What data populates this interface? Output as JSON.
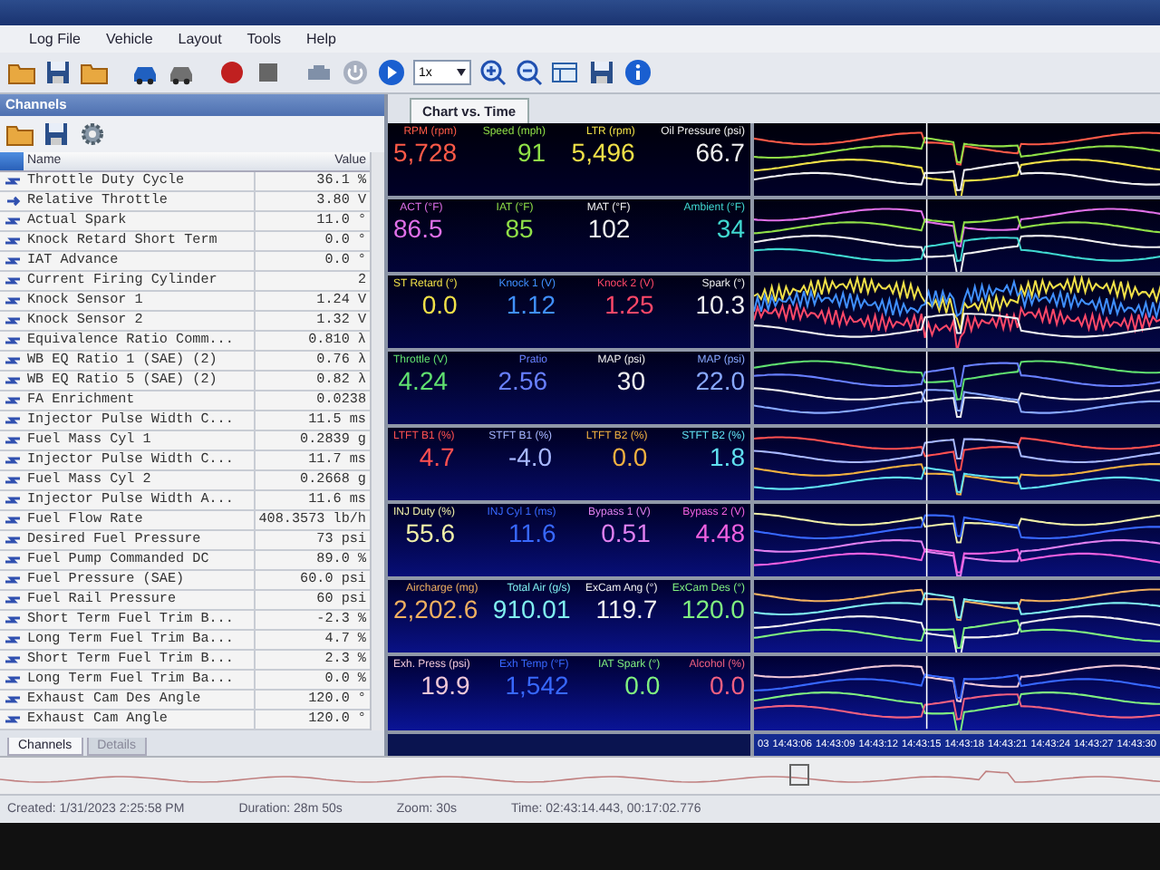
{
  "menu": [
    "Log File",
    "Vehicle",
    "Layout",
    "Tools",
    "Help"
  ],
  "toolbar": {
    "speed": "1x"
  },
  "channels_panel": {
    "title": "Channels",
    "columns": [
      "Name",
      "Value"
    ],
    "rows": [
      {
        "name": "Throttle Duty Cycle",
        "value": "36.1 %",
        "kind": "pair"
      },
      {
        "name": "Relative Throttle",
        "value": "3.80 V",
        "kind": "single"
      },
      {
        "name": "Actual Spark",
        "value": "11.0 °",
        "kind": "pair"
      },
      {
        "name": "Knock Retard Short Term",
        "value": "0.0 °",
        "kind": "pair"
      },
      {
        "name": "IAT Advance",
        "value": "0.0 °",
        "kind": "pair"
      },
      {
        "name": "Current Firing Cylinder",
        "value": "2",
        "kind": "pair"
      },
      {
        "name": "Knock Sensor 1",
        "value": "1.24 V",
        "kind": "pair"
      },
      {
        "name": "Knock Sensor 2",
        "value": "1.32 V",
        "kind": "pair"
      },
      {
        "name": "Equivalence Ratio Comm...",
        "value": "0.810 λ",
        "kind": "pair"
      },
      {
        "name": "WB EQ Ratio 1 (SAE) (2)",
        "value": "0.76 λ",
        "kind": "pair"
      },
      {
        "name": "WB EQ Ratio 5 (SAE) (2)",
        "value": "0.82 λ",
        "kind": "pair"
      },
      {
        "name": "FA Enrichment",
        "value": "0.0238",
        "kind": "pair"
      },
      {
        "name": "Injector Pulse Width C...",
        "value": "11.5 ms",
        "kind": "pair"
      },
      {
        "name": "Fuel Mass Cyl 1",
        "value": "0.2839 g",
        "kind": "pair"
      },
      {
        "name": "Injector Pulse Width C...",
        "value": "11.7 ms",
        "kind": "pair"
      },
      {
        "name": "Fuel Mass Cyl 2",
        "value": "0.2668 g",
        "kind": "pair"
      },
      {
        "name": "Injector Pulse Width A...",
        "value": "11.6 ms",
        "kind": "pair"
      },
      {
        "name": "Fuel Flow Rate",
        "value": "408.3573 lb/h",
        "kind": "pair"
      },
      {
        "name": "Desired Fuel Pressure",
        "value": "73 psi",
        "kind": "pair"
      },
      {
        "name": "Fuel Pump Commanded DC",
        "value": "89.0 %",
        "kind": "pair"
      },
      {
        "name": "Fuel Pressure (SAE)",
        "value": "60.0 psi",
        "kind": "pair"
      },
      {
        "name": "Fuel Rail Pressure",
        "value": "60 psi",
        "kind": "pair"
      },
      {
        "name": "Short Term Fuel Trim B...",
        "value": "-2.3 %",
        "kind": "pair"
      },
      {
        "name": "Long Term Fuel Trim Ba...",
        "value": "4.7 %",
        "kind": "pair"
      },
      {
        "name": "Short Term Fuel Trim B...",
        "value": "2.3 %",
        "kind": "pair"
      },
      {
        "name": "Long Term Fuel Trim Ba...",
        "value": "0.0 %",
        "kind": "pair"
      },
      {
        "name": "Exhaust Cam Des Angle",
        "value": "120.0 °",
        "kind": "pair"
      },
      {
        "name": "Exhaust Cam Angle",
        "value": "120.0 °",
        "kind": "pair"
      }
    ],
    "tabs": [
      {
        "label": "Channels",
        "selected": true
      },
      {
        "label": "Details",
        "selected": false
      }
    ]
  },
  "chart_tab": {
    "label": "Chart vs. Time",
    "selected": true
  },
  "gauge_rows": [
    [
      {
        "label": "RPM (rpm)",
        "value": "5,728",
        "color": "#ff5a48"
      },
      {
        "label": "Speed (mph)",
        "value": "91",
        "color": "#90e048"
      },
      {
        "label": "LTR (rpm)",
        "value": "5,496",
        "color": "#f0e048"
      },
      {
        "label": "Oil Pressure (psi)",
        "value": "66.7",
        "color": "#f0f0f0"
      }
    ],
    [
      {
        "label": "ACT (°F)",
        "value": "86.5",
        "color": "#e070e8"
      },
      {
        "label": "IAT (°F)",
        "value": "85",
        "color": "#90e048"
      },
      {
        "label": "MAT (°F)",
        "value": "102",
        "color": "#f0f0f0"
      },
      {
        "label": "Ambient (°F)",
        "value": "34",
        "color": "#40d8d0"
      }
    ],
    [
      {
        "label": "ST Retard (°)",
        "value": "0.0",
        "color": "#f0e048"
      },
      {
        "label": "Knock 1 (V)",
        "value": "1.12",
        "color": "#4090ff"
      },
      {
        "label": "Knock 2 (V)",
        "value": "1.25",
        "color": "#ff4868"
      },
      {
        "label": "Spark (°)",
        "value": "10.3",
        "color": "#f0f0f0"
      }
    ],
    [
      {
        "label": "Throttle (V)",
        "value": "4.24",
        "color": "#60e070"
      },
      {
        "label": "Pratio",
        "value": "2.56",
        "color": "#6880ff"
      },
      {
        "label": "MAP (psi)",
        "value": "30",
        "color": "#f0f0f0"
      },
      {
        "label": "MAP (psi)",
        "value": "22.0",
        "color": "#88a8ff"
      }
    ],
    [
      {
        "label": "LTFT B1 (%)",
        "value": "4.7",
        "color": "#ff5050"
      },
      {
        "label": "STFT B1 (%)",
        "value": "-4.0",
        "color": "#a8b8ff"
      },
      {
        "label": "LTFT B2 (%)",
        "value": "0.0",
        "color": "#f0b040"
      },
      {
        "label": "STFT B2 (%)",
        "value": "1.8",
        "color": "#60e0f0"
      }
    ],
    [
      {
        "label": "INJ Duty (%)",
        "value": "55.6",
        "color": "#f0f0a8"
      },
      {
        "label": "INJ Cyl 1 (ms)",
        "value": "11.6",
        "color": "#3868ff"
      },
      {
        "label": "Bypass 1 (V)",
        "value": "0.51",
        "color": "#e080f0"
      },
      {
        "label": "Bypass 2 (V)",
        "value": "4.48",
        "color": "#f060e0"
      }
    ],
    [
      {
        "label": "Aircharge (mg)",
        "value": "2,202.6",
        "color": "#f0b060"
      },
      {
        "label": "Total Air (g/s)",
        "value": "910.01",
        "color": "#80f0f0"
      },
      {
        "label": "ExCam Ang (°)",
        "value": "119.7",
        "color": "#f0f0f0"
      },
      {
        "label": "ExCam Des (°)",
        "value": "120.0",
        "color": "#80f080"
      }
    ],
    [
      {
        "label": "Exh. Press (psi)",
        "value": "19.9",
        "color": "#f0c8d8"
      },
      {
        "label": "Exh Temp (°F)",
        "value": "1,542",
        "color": "#3868ff"
      },
      {
        "label": "IAT Spark (°)",
        "value": "0.0",
        "color": "#80f080"
      },
      {
        "label": "Alcohol (%)",
        "value": "0.0",
        "color": "#f06080"
      }
    ]
  ],
  "time_axis": [
    "03",
    "14:43:06",
    "14:43:09",
    "14:43:12",
    "14:43:15",
    "14:43:18",
    "14:43:21",
    "14:43:24",
    "14:43:27",
    "14:43:30"
  ],
  "status_bar": [
    "Created: 1/31/2023 2:25:58 PM",
    "Duration: 28m 50s",
    "Zoom: 30s",
    "Time: 02:43:14.443, 00:17:02.776"
  ]
}
